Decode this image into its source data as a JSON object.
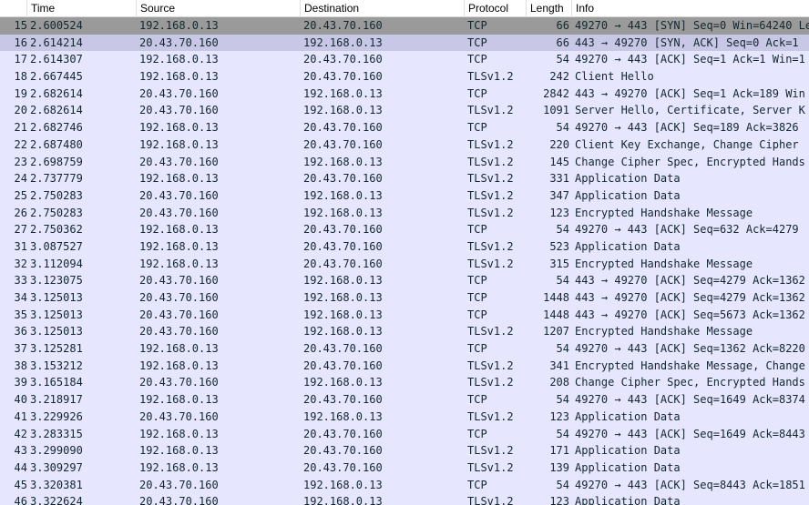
{
  "columns": {
    "no": "",
    "time": "Time",
    "source": "Source",
    "destination": "Destination",
    "protocol": "Protocol",
    "length": "Length",
    "info": "Info"
  },
  "packets": [
    {
      "no": "15",
      "time": "2.600524",
      "source": "192.168.0.13",
      "destination": "20.43.70.160",
      "protocol": "TCP",
      "length": "66",
      "info": "49270 → 443 [SYN] Seq=0 Win=64240 Le"
    },
    {
      "no": "16",
      "time": "2.614214",
      "source": "20.43.70.160",
      "destination": "192.168.0.13",
      "protocol": "TCP",
      "length": "66",
      "info": "443 → 49270 [SYN, ACK] Seq=0 Ack=1"
    },
    {
      "no": "17",
      "time": "2.614307",
      "source": "192.168.0.13",
      "destination": "20.43.70.160",
      "protocol": "TCP",
      "length": "54",
      "info": "49270 → 443 [ACK] Seq=1 Ack=1 Win=1"
    },
    {
      "no": "18",
      "time": "2.667445",
      "source": "192.168.0.13",
      "destination": "20.43.70.160",
      "protocol": "TLSv1.2",
      "length": "242",
      "info": "Client Hello"
    },
    {
      "no": "19",
      "time": "2.682614",
      "source": "20.43.70.160",
      "destination": "192.168.0.13",
      "protocol": "TCP",
      "length": "2842",
      "info": "443 → 49270 [ACK] Seq=1 Ack=189 Win"
    },
    {
      "no": "20",
      "time": "2.682614",
      "source": "20.43.70.160",
      "destination": "192.168.0.13",
      "protocol": "TLSv1.2",
      "length": "1091",
      "info": "Server Hello, Certificate, Server K"
    },
    {
      "no": "21",
      "time": "2.682746",
      "source": "192.168.0.13",
      "destination": "20.43.70.160",
      "protocol": "TCP",
      "length": "54",
      "info": "49270 → 443 [ACK] Seq=189 Ack=3826"
    },
    {
      "no": "22",
      "time": "2.687480",
      "source": "192.168.0.13",
      "destination": "20.43.70.160",
      "protocol": "TLSv1.2",
      "length": "220",
      "info": "Client Key Exchange, Change Cipher"
    },
    {
      "no": "23",
      "time": "2.698759",
      "source": "20.43.70.160",
      "destination": "192.168.0.13",
      "protocol": "TLSv1.2",
      "length": "145",
      "info": "Change Cipher Spec, Encrypted Hands"
    },
    {
      "no": "24",
      "time": "2.737779",
      "source": "192.168.0.13",
      "destination": "20.43.70.160",
      "protocol": "TLSv1.2",
      "length": "331",
      "info": "Application Data"
    },
    {
      "no": "25",
      "time": "2.750283",
      "source": "20.43.70.160",
      "destination": "192.168.0.13",
      "protocol": "TLSv1.2",
      "length": "347",
      "info": "Application Data"
    },
    {
      "no": "26",
      "time": "2.750283",
      "source": "20.43.70.160",
      "destination": "192.168.0.13",
      "protocol": "TLSv1.2",
      "length": "123",
      "info": "Encrypted Handshake Message"
    },
    {
      "no": "27",
      "time": "2.750362",
      "source": "192.168.0.13",
      "destination": "20.43.70.160",
      "protocol": "TCP",
      "length": "54",
      "info": "49270 → 443 [ACK] Seq=632 Ack=4279"
    },
    {
      "no": "31",
      "time": "3.087527",
      "source": "192.168.0.13",
      "destination": "20.43.70.160",
      "protocol": "TLSv1.2",
      "length": "523",
      "info": "Application Data"
    },
    {
      "no": "32",
      "time": "3.112094",
      "source": "192.168.0.13",
      "destination": "20.43.70.160",
      "protocol": "TLSv1.2",
      "length": "315",
      "info": "Encrypted Handshake Message"
    },
    {
      "no": "33",
      "time": "3.123075",
      "source": "20.43.70.160",
      "destination": "192.168.0.13",
      "protocol": "TCP",
      "length": "54",
      "info": "443 → 49270 [ACK] Seq=4279 Ack=1362"
    },
    {
      "no": "34",
      "time": "3.125013",
      "source": "20.43.70.160",
      "destination": "192.168.0.13",
      "protocol": "TCP",
      "length": "1448",
      "info": "443 → 49270 [ACK] Seq=4279 Ack=1362"
    },
    {
      "no": "35",
      "time": "3.125013",
      "source": "20.43.70.160",
      "destination": "192.168.0.13",
      "protocol": "TCP",
      "length": "1448",
      "info": "443 → 49270 [ACK] Seq=5673 Ack=1362"
    },
    {
      "no": "36",
      "time": "3.125013",
      "source": "20.43.70.160",
      "destination": "192.168.0.13",
      "protocol": "TLSv1.2",
      "length": "1207",
      "info": "Encrypted Handshake Message"
    },
    {
      "no": "37",
      "time": "3.125281",
      "source": "192.168.0.13",
      "destination": "20.43.70.160",
      "protocol": "TCP",
      "length": "54",
      "info": "49270 → 443 [ACK] Seq=1362 Ack=8220"
    },
    {
      "no": "38",
      "time": "3.153212",
      "source": "192.168.0.13",
      "destination": "20.43.70.160",
      "protocol": "TLSv1.2",
      "length": "341",
      "info": "Encrypted Handshake Message, Change"
    },
    {
      "no": "39",
      "time": "3.165184",
      "source": "20.43.70.160",
      "destination": "192.168.0.13",
      "protocol": "TLSv1.2",
      "length": "208",
      "info": "Change Cipher Spec, Encrypted Hands"
    },
    {
      "no": "40",
      "time": "3.218917",
      "source": "192.168.0.13",
      "destination": "20.43.70.160",
      "protocol": "TCP",
      "length": "54",
      "info": "49270 → 443 [ACK] Seq=1649 Ack=8374"
    },
    {
      "no": "41",
      "time": "3.229926",
      "source": "20.43.70.160",
      "destination": "192.168.0.13",
      "protocol": "TLSv1.2",
      "length": "123",
      "info": "Application Data"
    },
    {
      "no": "42",
      "time": "3.283315",
      "source": "192.168.0.13",
      "destination": "20.43.70.160",
      "protocol": "TCP",
      "length": "54",
      "info": "49270 → 443 [ACK] Seq=1649 Ack=8443"
    },
    {
      "no": "43",
      "time": "3.299090",
      "source": "192.168.0.13",
      "destination": "20.43.70.160",
      "protocol": "TLSv1.2",
      "length": "171",
      "info": "Application Data"
    },
    {
      "no": "44",
      "time": "3.309297",
      "source": "192.168.0.13",
      "destination": "20.43.70.160",
      "protocol": "TLSv1.2",
      "length": "139",
      "info": "Application Data"
    },
    {
      "no": "45",
      "time": "3.320381",
      "source": "20.43.70.160",
      "destination": "192.168.0.13",
      "protocol": "TCP",
      "length": "54",
      "info": "49270 → 443 [ACK] Seq=8443 Ack=1851"
    },
    {
      "no": "46",
      "time": "3.322624",
      "source": "20.43.70.160",
      "destination": "192.168.0.13",
      "protocol": "TLSv1.2",
      "length": "123",
      "info": "Application Data"
    }
  ],
  "colors": {
    "row_background": "#e7e6ff",
    "selected_row": "#9a9a9a",
    "related_row": "#c8c8e6",
    "text": "#12272e"
  }
}
